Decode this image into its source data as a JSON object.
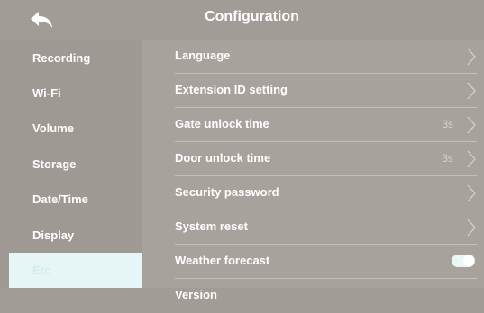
{
  "header": {
    "title": "Configuration",
    "back_icon": "back-arrow-icon"
  },
  "sidebar": {
    "items": [
      {
        "label": "Recording"
      },
      {
        "label": "Wi-Fi"
      },
      {
        "label": "Volume"
      },
      {
        "label": "Storage"
      },
      {
        "label": "Date/Time"
      },
      {
        "label": "Display"
      },
      {
        "label": "Etc",
        "active": true
      }
    ],
    "active_color": "#e6f6f6"
  },
  "settings": [
    {
      "label": "Language",
      "value": "",
      "control": "chevron"
    },
    {
      "label": "Extension ID setting",
      "value": "",
      "control": "chevron"
    },
    {
      "label": "Gate  unlock time",
      "value": "3s",
      "control": "chevron"
    },
    {
      "label": "Door  unlock time",
      "value": "3s",
      "control": "chevron"
    },
    {
      "label": "Security password",
      "value": "",
      "control": "chevron"
    },
    {
      "label": "System reset",
      "value": "",
      "control": "chevron"
    },
    {
      "label": "Weather forecast",
      "value": "",
      "control": "toggle",
      "enabled": true
    },
    {
      "label": "Version",
      "value": "",
      "control": "none"
    }
  ]
}
